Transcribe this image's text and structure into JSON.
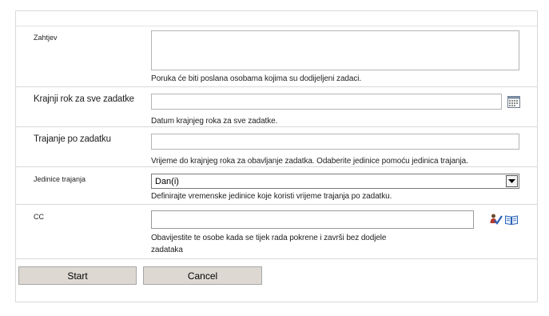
{
  "fields": {
    "request": {
      "label": "Zahtjev",
      "value": "",
      "description": "Poruka će biti poslana osobama kojima su dodijeljeni zadaci."
    },
    "due_date": {
      "label": "Krajnji rok za sve zadatke",
      "value": "",
      "description": "Datum krajnjeg roka za sve zadatke."
    },
    "duration": {
      "label": "Trajanje po zadatku",
      "value": "",
      "description": "Vrijeme do krajnjeg roka za obavljanje zadatka. Odaberite jedinice pomoću jedinica trajanja."
    },
    "duration_units": {
      "label": "Jedinice trajanja",
      "selected": "Dan(i)",
      "description": "Definirajte vremenske jedinice koje koristi vrijeme trajanja po zadatku."
    },
    "cc": {
      "label": "CC",
      "value": "",
      "description_line1": "Obavijestite te osobe kada se tijek rada pokrene i završi bez dodjele",
      "description_line2": "zadataka"
    }
  },
  "icons": {
    "calendar": "calendar-icon",
    "check_names": "check-names-icon",
    "address_book": "address-book-icon"
  },
  "buttons": {
    "start": "Start",
    "cancel": "Cancel"
  }
}
